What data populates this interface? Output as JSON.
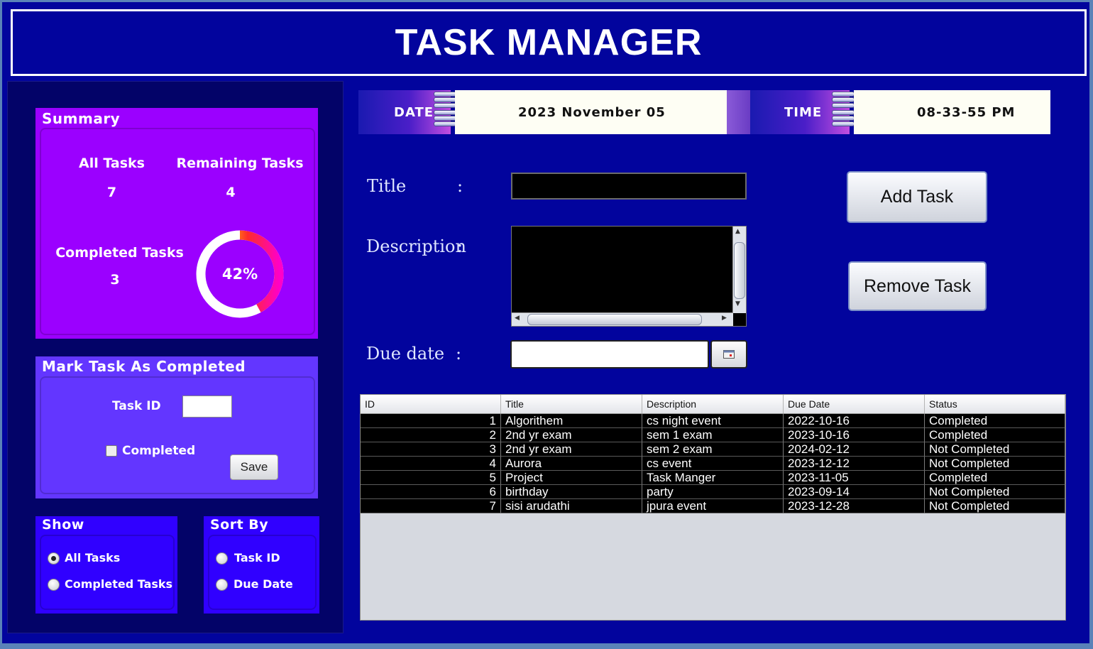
{
  "app": {
    "title": "TASK MANAGER"
  },
  "summary": {
    "title": "Summary",
    "all_tasks_label": "All Tasks",
    "all_tasks_value": "7",
    "remaining_label": "Remaining Tasks",
    "remaining_value": "4",
    "completed_label": "Completed Tasks",
    "completed_value": "3",
    "progress_text": "42%",
    "progress_fraction": 0.42
  },
  "mark_completed": {
    "title": "Mark Task As Completed",
    "task_id_label": "Task ID",
    "task_id_value": "",
    "checkbox_label": "Completed",
    "save_label": "Save"
  },
  "show": {
    "title": "Show",
    "options": [
      "All Tasks",
      "Completed Tasks"
    ],
    "selected": "All Tasks"
  },
  "sort": {
    "title": "Sort By",
    "options": [
      "Task ID",
      "Due Date"
    ]
  },
  "datetime": {
    "date_label": "DATE",
    "date_value": "2023 November 05",
    "time_label": "TIME",
    "time_value": "08-33-55 PM"
  },
  "form": {
    "title_label": "Title",
    "description_label": "Description",
    "due_date_label": "Due date",
    "colon": ":",
    "title_value": "",
    "description_value": "",
    "due_date_value": ""
  },
  "buttons": {
    "add_task": "Add Task",
    "remove_task": "Remove Task"
  },
  "table": {
    "columns": [
      "ID",
      "Title",
      "Description",
      "Due Date",
      "Status"
    ],
    "rows": [
      [
        "1",
        "Algorithem",
        "cs night event",
        "2022-10-16",
        "Completed"
      ],
      [
        "2",
        "2nd yr exam",
        "sem 1 exam",
        "2023-10-16",
        "Completed"
      ],
      [
        "3",
        "2nd yr exam",
        "sem 2 exam",
        "2024-02-12",
        "Not Completed"
      ],
      [
        "4",
        "Aurora",
        "cs event",
        "2023-12-12",
        "Not Completed"
      ],
      [
        "5",
        "Project",
        "Task Manger",
        "2023-11-05",
        "Completed"
      ],
      [
        "6",
        "birthday",
        "party",
        "2023-09-14",
        "Not Completed"
      ],
      [
        "7",
        "sisi arudathi",
        "jpura event",
        "2023-12-28",
        "Not Completed"
      ]
    ]
  },
  "colors": {
    "background": "#02049d",
    "summary_bg": "#9b00ff",
    "mark_bg": "#6336ff",
    "filter_bg": "#3000ff"
  }
}
